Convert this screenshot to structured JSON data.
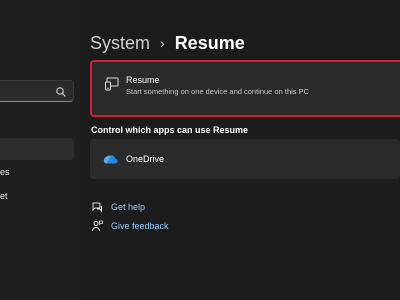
{
  "breadcrumb": {
    "parent": "System",
    "separator": "›",
    "current": "Resume"
  },
  "sidebar": {
    "search_placeholder": "",
    "partial_items": [
      "es",
      "et"
    ]
  },
  "resume_setting": {
    "title": "Resume",
    "description": "Start something on one device and continue on this PC"
  },
  "apps_section": {
    "heading": "Control which apps can use Resume",
    "apps": [
      {
        "name": "OneDrive",
        "icon": "onedrive-cloud-icon"
      }
    ]
  },
  "help_links": [
    {
      "label": "Get help",
      "icon": "help-chat-icon"
    },
    {
      "label": "Give feedback",
      "icon": "feedback-person-icon"
    }
  ],
  "colors": {
    "background": "#1c1c1c",
    "card": "#2b2b2b",
    "highlight": "#d31f2f",
    "link": "#99ccff",
    "onedrive": "#2b88d8"
  }
}
